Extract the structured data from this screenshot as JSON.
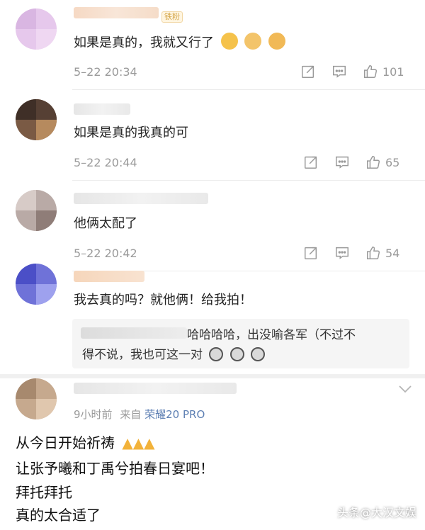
{
  "comments": [
    {
      "content": "如果是真的，我就又行了",
      "badge": "铁粉",
      "time": "5–22 20:34",
      "likes": "101",
      "emojis": [
        "dog-emoji",
        "dog-emoji",
        "dog-emoji"
      ]
    },
    {
      "content": "如果是真的我真的可",
      "time": "5–22 20:44",
      "likes": "65"
    },
    {
      "content": "他俩太配了",
      "time": "5–22 20:42",
      "likes": "54"
    },
    {
      "content": "我去真的吗？就他俩！给我拍！",
      "reply": {
        "line1": "哈哈哈哈，出没喻各军（不过不",
        "line2": "得不说，我也可这一对"
      }
    },
    {
      "meta_time": "9小时前",
      "meta_from": "来自",
      "meta_device": "荣耀20 PRO",
      "lines": [
        "从今日开始祈祷",
        "让张予曦和丁禹兮拍春日宴吧！",
        "拜托拜托",
        "真的太合适了"
      ]
    }
  ],
  "watermark": "头条@大汉文娱",
  "colors": {
    "meta_gray": "#9a9a9a",
    "device_blue": "#5d7fb3",
    "badge_gold": "#d4a64a"
  }
}
